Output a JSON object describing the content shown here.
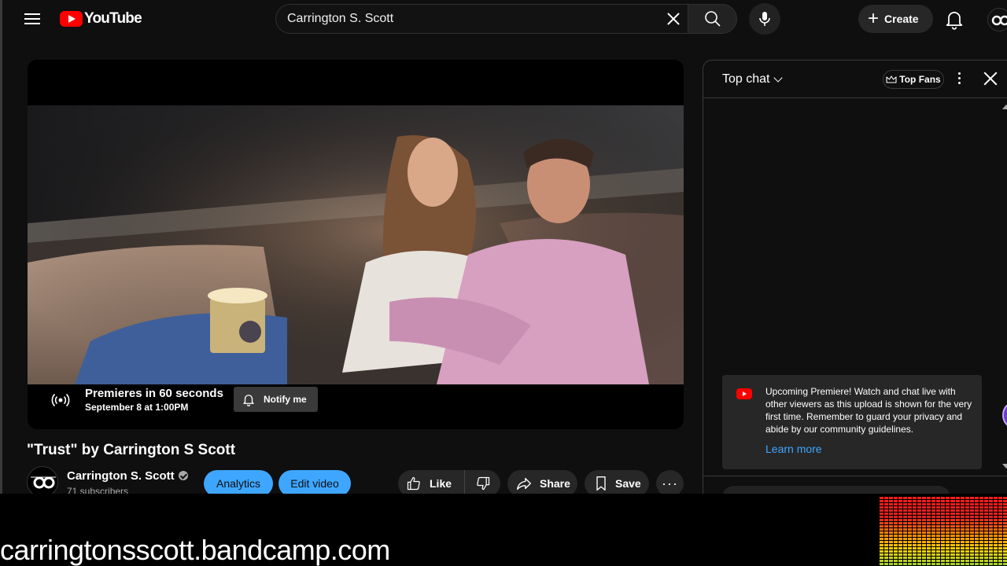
{
  "header": {
    "logo_text": "YouTube",
    "search_value": "Carrington S. Scott",
    "create_label": "Create",
    "avatar_icon": "channel-avatar-icon"
  },
  "player": {
    "premiere_title": "Premieres in 60 seconds",
    "premiere_date": "September 8 at 1:00PM",
    "notify_label": "Notify me"
  },
  "video": {
    "title": "\"Trust\" by Carrington S Scott",
    "channel_name": "Carrington S. Scott",
    "subscribers": "71 subscribers",
    "analytics_label": "Analytics",
    "edit_label": "Edit video",
    "like_label": "Like",
    "share_label": "Share",
    "save_label": "Save"
  },
  "chat": {
    "mode_label": "Top chat",
    "top_fans_label": "Top Fans",
    "notice_text": "Upcoming Premiere! Watch and chat live with other viewers as this upload is shown for the very first time. Remember to guard your privacy and abide by our community guidelines.",
    "learn_more_label": "Learn more"
  },
  "overlay": {
    "url_text": "carringtonsscott.bandcamp.com"
  },
  "colors": {
    "brand_red": "#ff0000",
    "accent_blue": "#3ea6ff",
    "background": "#0f0f0f"
  }
}
